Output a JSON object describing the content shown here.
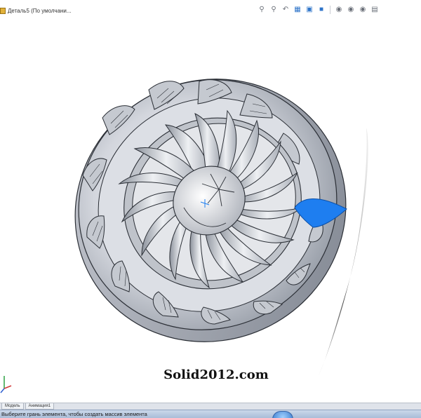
{
  "document_tab": {
    "title": "Деталь5 (По умолчани..."
  },
  "heads_up_toolbar": {
    "icons": [
      "zoom-to-fit-icon",
      "zoom-area-icon",
      "previous-view-icon",
      "section-view-icon",
      "view-orientation-icon",
      "display-style-icon",
      "hide-show-icon",
      "edit-appearance-icon",
      "scene-icon",
      "view-settings-icon"
    ]
  },
  "model": {
    "description_icons": [
      "impeller-model"
    ],
    "highlight_color": "#1e7ef0",
    "body_color": "#c9ccd3",
    "edge_color": "#2b2f36"
  },
  "watermark": {
    "text": "Solid2012.com"
  },
  "model_tabs": [
    "Модель",
    "Анимация1"
  ],
  "status_bar": {
    "text": "Выберите грань элемента, чтобы создать массив элемента"
  }
}
